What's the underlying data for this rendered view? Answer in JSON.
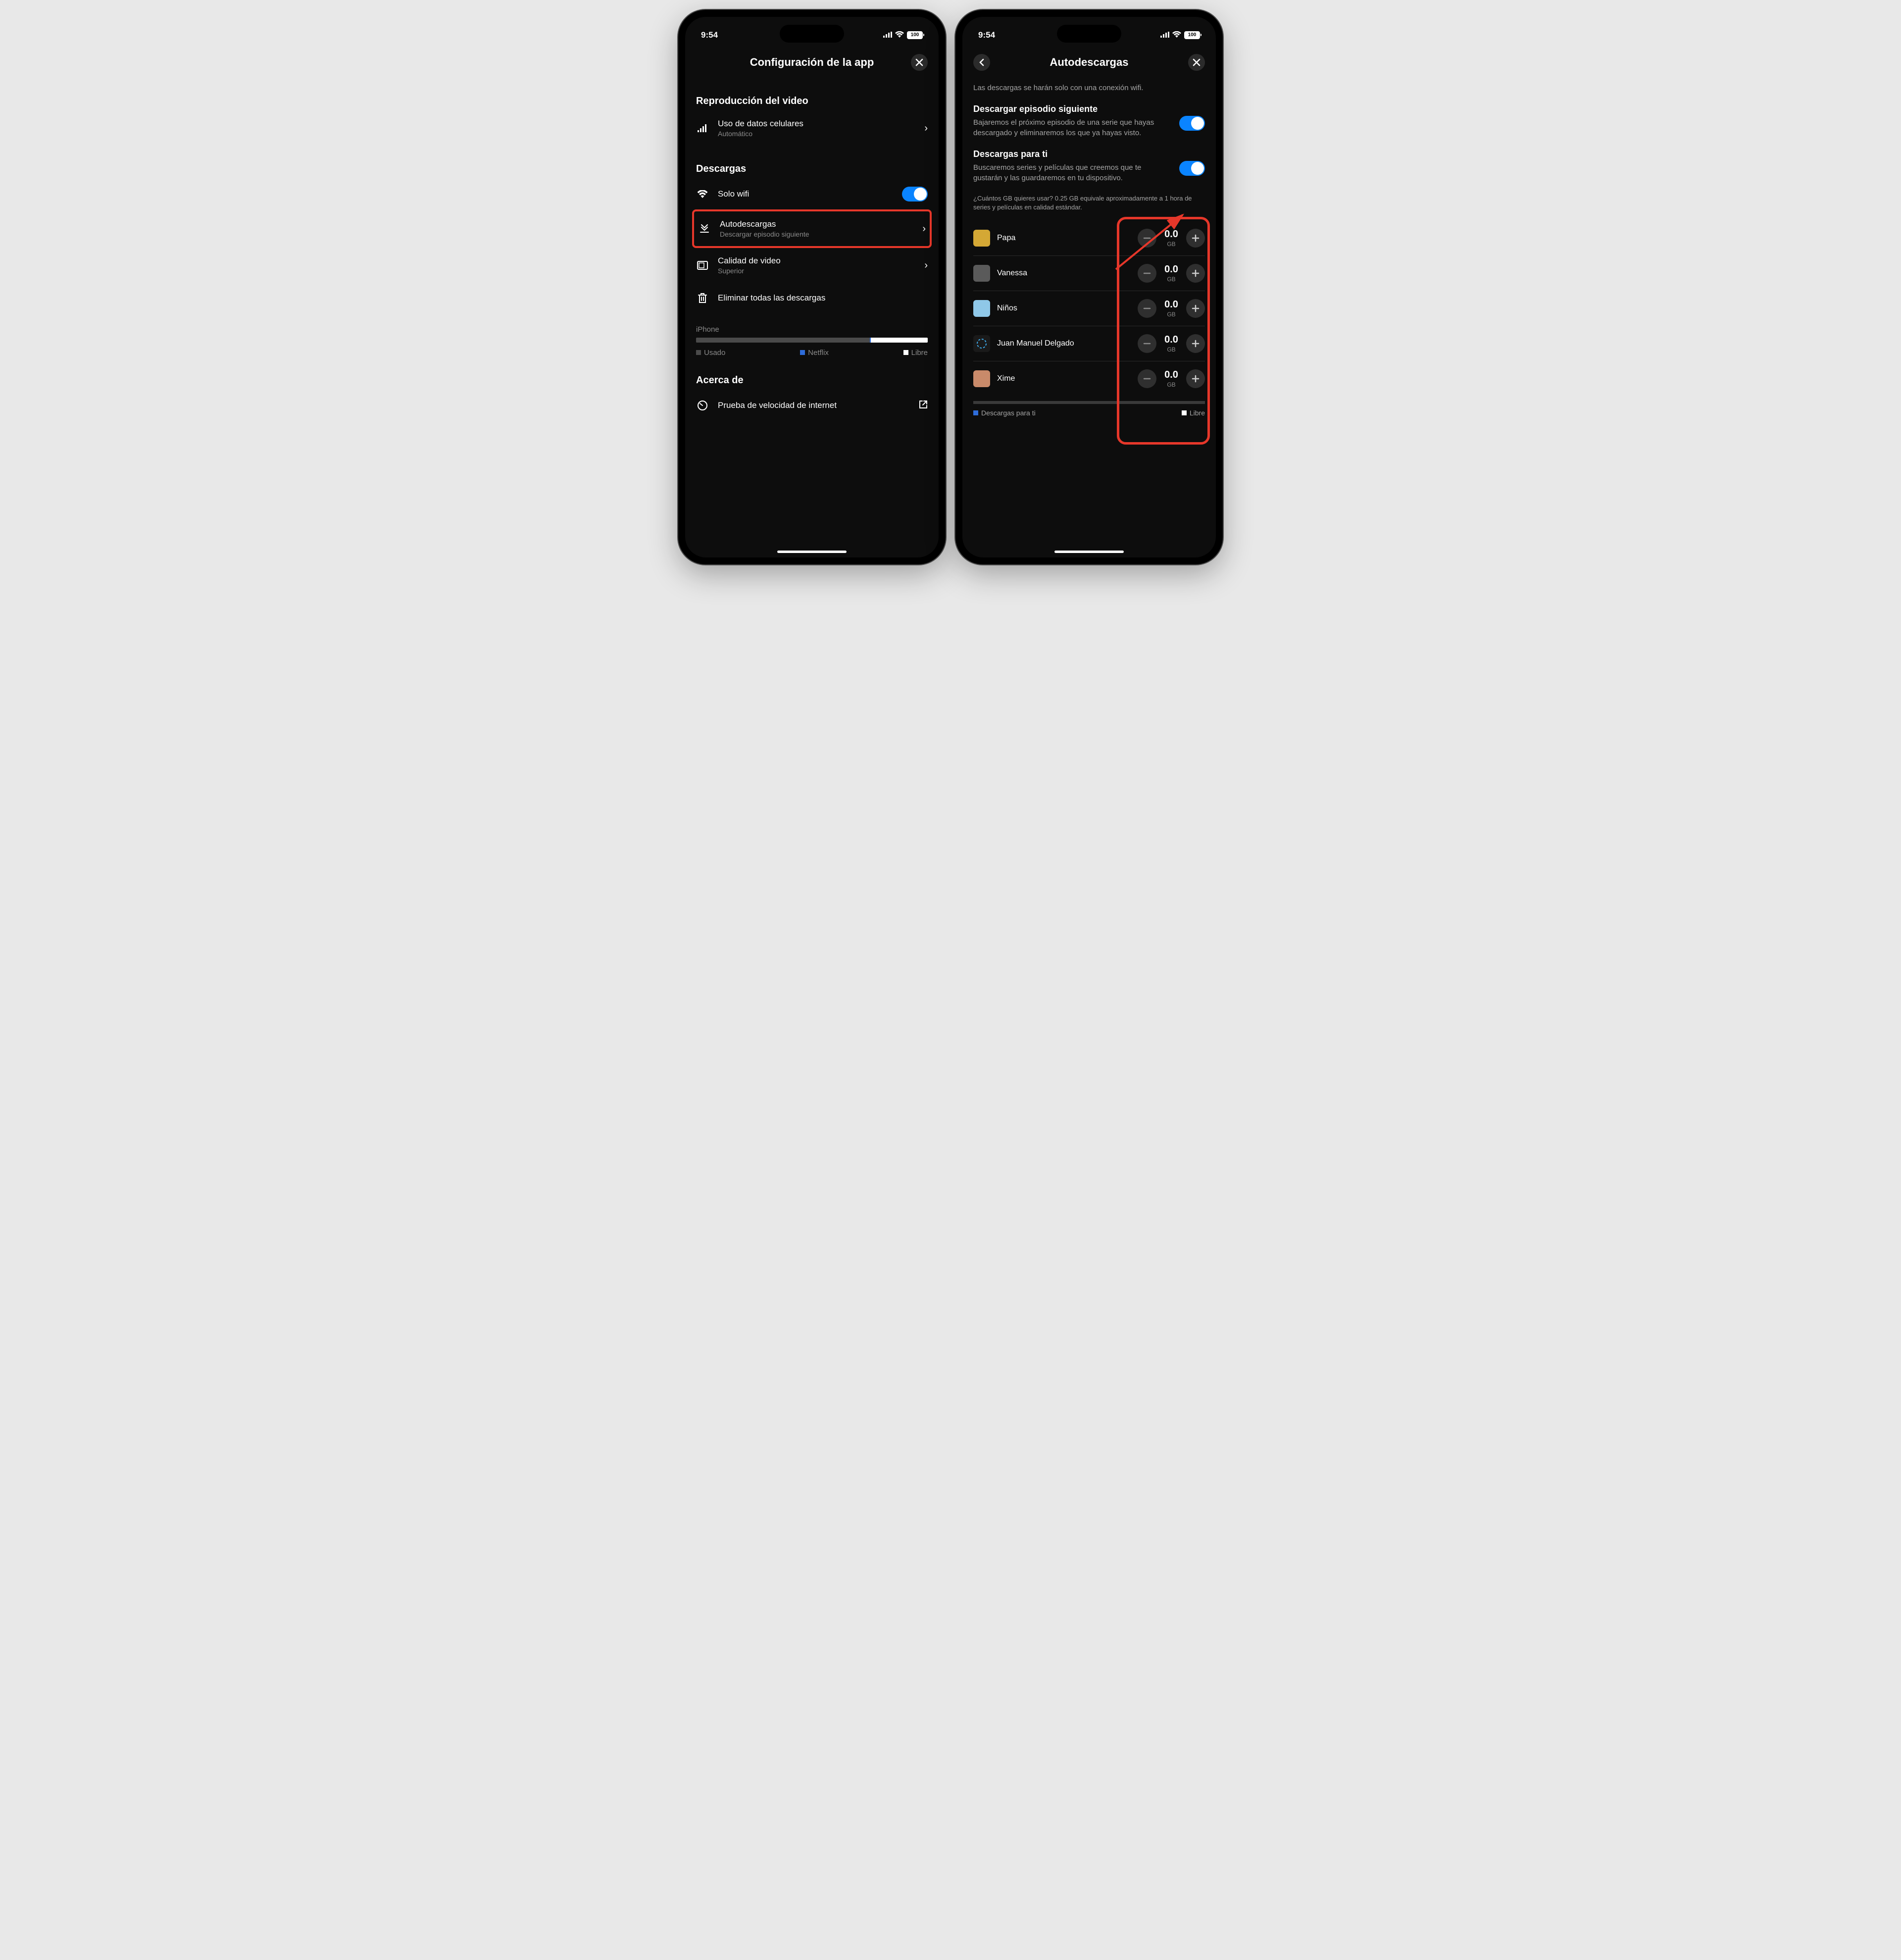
{
  "statusBar": {
    "time": "9:54",
    "battery": "100"
  },
  "left": {
    "title": "Configuración de la app",
    "section1": "Reproducción del video",
    "cellular": {
      "label": "Uso de datos celulares",
      "sub": "Automático"
    },
    "section2": "Descargas",
    "wifiOnly": "Solo wifi",
    "auto": {
      "label": "Autodescargas",
      "sub": "Descargar episodio siguiente"
    },
    "quality": {
      "label": "Calidad de video",
      "sub": "Superior"
    },
    "deleteAll": "Eliminar todas las descargas",
    "storageDevice": "iPhone",
    "legend": {
      "used": "Usado",
      "netflix": "Netflix",
      "free": "Libre"
    },
    "section3": "Acerca de",
    "speedTest": "Prueba de velocidad de internet"
  },
  "right": {
    "title": "Autodescargas",
    "wifiNote": "Las descargas se harán solo con una conexión wifi.",
    "nextEp": {
      "title": "Descargar episodio siguiente",
      "desc": "Bajaremos el próximo episodio de una serie que hayas descargado y eliminaremos los que ya hayas visto."
    },
    "forYou": {
      "title": "Descargas para ti",
      "desc": "Buscaremos series y películas que creemos que te gustarán y las guardaremos en tu dispositivo."
    },
    "gbHint": "¿Cuántos GB quieres usar? 0.25 GB equivale aproximadamente a 1 hora de series y películas en calidad estándar.",
    "profiles": [
      {
        "name": "Papa",
        "value": "0.0",
        "unit": "GB",
        "color": "#d4a835"
      },
      {
        "name": "Vanessa",
        "value": "0.0",
        "unit": "GB",
        "color": "#5a5a5a"
      },
      {
        "name": "Niños",
        "value": "0.0",
        "unit": "GB",
        "color": "#8fc8e8"
      },
      {
        "name": "Juan Manuel Delgado",
        "value": "0.0",
        "unit": "GB",
        "color": "#1a1a1a"
      },
      {
        "name": "Xime",
        "value": "0.0",
        "unit": "GB",
        "color": "#c98a6a"
      }
    ],
    "bottomLegend": {
      "left": "Descargas para ti",
      "right": "Libre"
    }
  }
}
